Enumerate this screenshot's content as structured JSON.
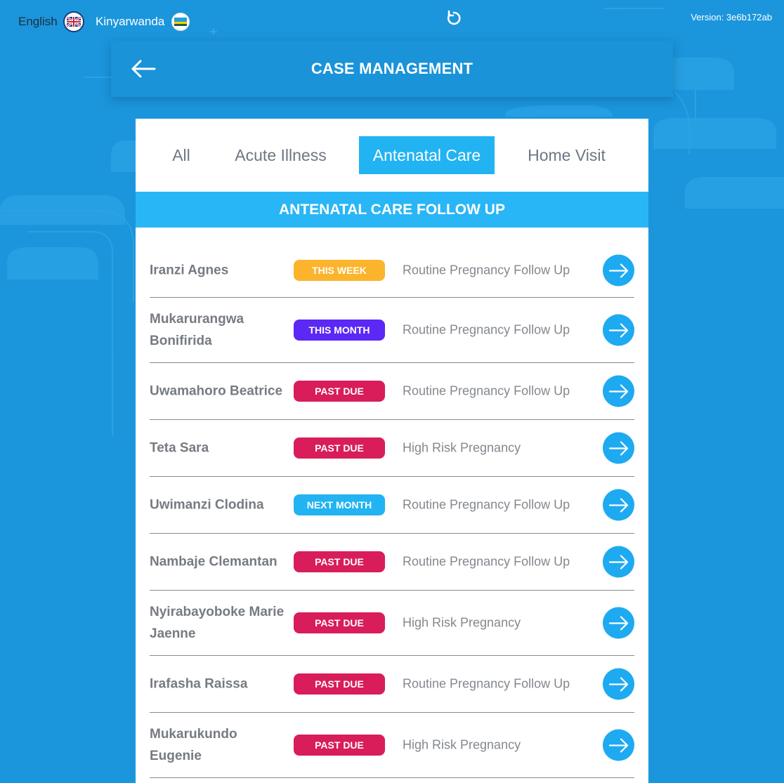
{
  "topbar": {
    "lang_english": "English",
    "lang_kinyarwanda": "Kinyarwanda",
    "version": "Version: 3e6b172ab"
  },
  "header": {
    "title": "CASE MANAGEMENT"
  },
  "tabs": [
    "All",
    "Acute Illness",
    "Antenatal Care",
    "Home Visit"
  ],
  "active_tab": "Antenatal Care",
  "section_title": "ANTENATAL CARE FOLLOW UP",
  "rows": [
    {
      "name": "Iranzi Agnes",
      "status": "THIS WEEK",
      "status_type": "week",
      "visit": "Routine Pregnancy Follow Up"
    },
    {
      "name": "Mukarurangwa Bonifirida",
      "status": "THIS MONTH",
      "status_type": "month",
      "visit": "Routine Pregnancy Follow Up"
    },
    {
      "name": "Uwamahoro Beatrice",
      "status": "PAST DUE",
      "status_type": "past",
      "visit": "Routine Pregnancy Follow Up"
    },
    {
      "name": "Teta Sara",
      "status": "PAST DUE",
      "status_type": "past",
      "visit": "High Risk Pregnancy"
    },
    {
      "name": "Uwimanzi Clodina",
      "status": "NEXT MONTH",
      "status_type": "next",
      "visit": "Routine Pregnancy Follow Up"
    },
    {
      "name": "Nambaje Clemantan",
      "status": "PAST DUE",
      "status_type": "past",
      "visit": "Routine Pregnancy Follow Up"
    },
    {
      "name": "Nyirabayoboke Marie Jaenne",
      "status": "PAST DUE",
      "status_type": "past",
      "visit": "High Risk Pregnancy"
    },
    {
      "name": "Irafasha Raissa",
      "status": "PAST DUE",
      "status_type": "past",
      "visit": "Routine Pregnancy Follow Up"
    },
    {
      "name": "Mukarukundo Eugenie",
      "status": "PAST DUE",
      "status_type": "past",
      "visit": "High Risk Pregnancy"
    }
  ],
  "colors": {
    "background": "#1b96dc",
    "accent": "#29b6f6",
    "this_week": "#fbb42c",
    "this_month": "#5b28f5",
    "past_due": "#d81d5a",
    "next_month": "#22b3f2"
  },
  "icons": {
    "back": "arrow-left-icon",
    "refresh": "refresh-icon",
    "row_action": "arrow-right-circle-icon",
    "flag_en": "uk-flag-icon",
    "flag_rw": "rwanda-flag-icon"
  }
}
